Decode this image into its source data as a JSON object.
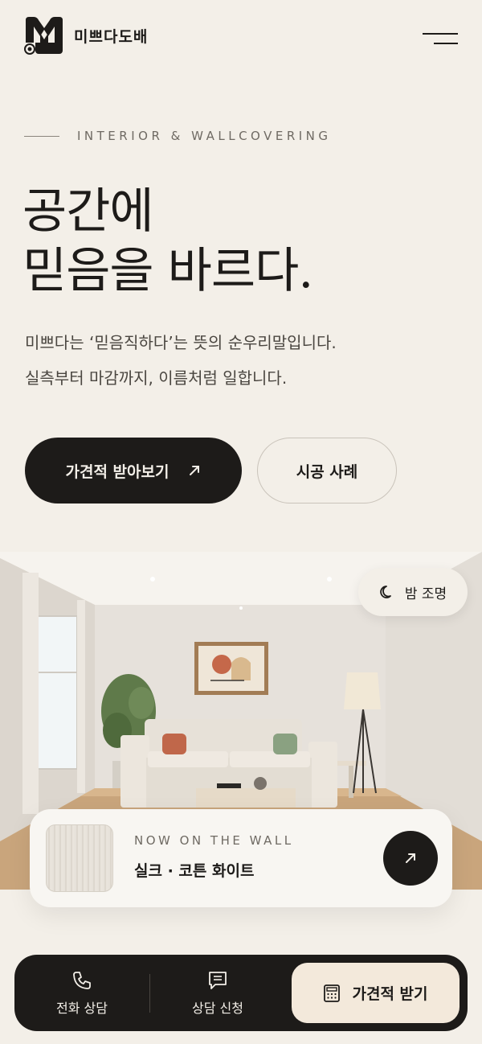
{
  "header": {
    "brand": "미쁘다도배",
    "logo_icon": "brand-logo",
    "menu_icon": "hamburger-menu-icon"
  },
  "hero": {
    "eyebrow": "INTERIOR & WALLCOVERING",
    "headline_line1": "공간에",
    "headline_line2": "믿음을 바르다.",
    "sub_line1": "미쁘다는 ‘믿음직하다’는 뜻의 순우리말입니다.",
    "sub_line2": "실측부터 마감까지, 이름처럼 일합니다.",
    "primary_button": "가견적 받아보기",
    "secondary_button": "시공 사례"
  },
  "room": {
    "night_toggle_label": "밤 조명",
    "night_toggle_icon": "moon-icon"
  },
  "wall_card": {
    "eyebrow": "NOW ON THE WALL",
    "title": "실크 · 코튼 화이트",
    "action_icon": "arrow-up-right-icon"
  },
  "bottom_bar": {
    "call_label": "전화 상담",
    "call_icon": "phone-icon",
    "consult_label": "상담 신청",
    "consult_icon": "message-icon",
    "quote_label": "가견적 받기",
    "quote_icon": "calculator-icon"
  },
  "colors": {
    "background": "#f3efe8",
    "ink": "#1d1b19",
    "accent_cream": "#f3e9db",
    "pillow_orange": "#c0674a",
    "pillow_green": "#8aa181"
  }
}
